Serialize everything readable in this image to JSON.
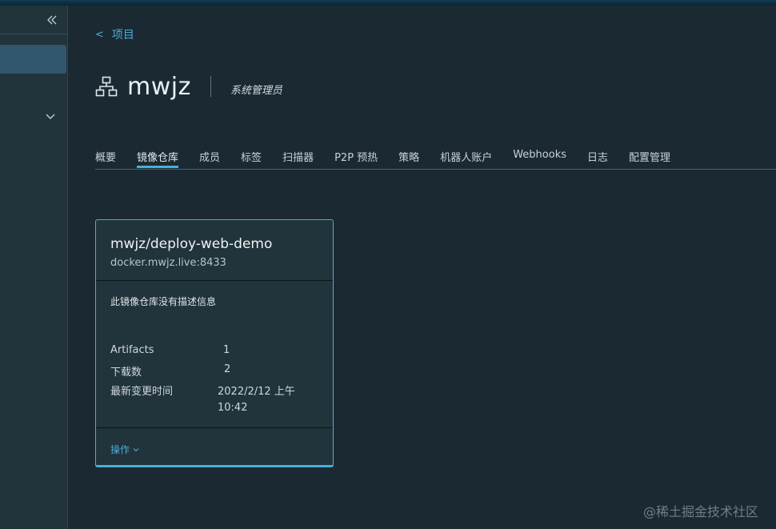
{
  "colors": {
    "accent": "#49afd9",
    "background": "#1b2a32",
    "sidebar": "#21333b",
    "card": "#21333b"
  },
  "sidebar": {
    "collapse_icon": "double-chevron-left-icon",
    "expand_icon": "chevron-down-icon"
  },
  "breadcrumb": {
    "back_label": "项目",
    "back_icon": "chevron-left-icon"
  },
  "header": {
    "icon": "project-hierarchy-icon",
    "title": "mwjz",
    "role": "系统管理员"
  },
  "tabs": [
    {
      "label": "概要",
      "active": false
    },
    {
      "label": "镜像仓库",
      "active": true
    },
    {
      "label": "成员",
      "active": false
    },
    {
      "label": "标签",
      "active": false
    },
    {
      "label": "扫描器",
      "active": false
    },
    {
      "label": "P2P 预热",
      "active": false
    },
    {
      "label": "策略",
      "active": false
    },
    {
      "label": "机器人账户",
      "active": false
    },
    {
      "label": "Webhooks",
      "active": false
    },
    {
      "label": "日志",
      "active": false
    },
    {
      "label": "配置管理",
      "active": false
    }
  ],
  "repo_card": {
    "name": "mwjz/deploy-web-demo",
    "registry": "docker.mwjz.live:8433",
    "description": "此镜像仓库没有描述信息",
    "stats": {
      "artifacts_label": "Artifacts",
      "artifacts_value": "1",
      "downloads_label": "下载数",
      "downloads_value": "2",
      "updated_label": "最新变更时间",
      "updated_value_line1": "2022/2/12 上午",
      "updated_value_line2": "10:42"
    },
    "actions_label": "操作"
  },
  "watermark": "@稀土掘金技术社区"
}
